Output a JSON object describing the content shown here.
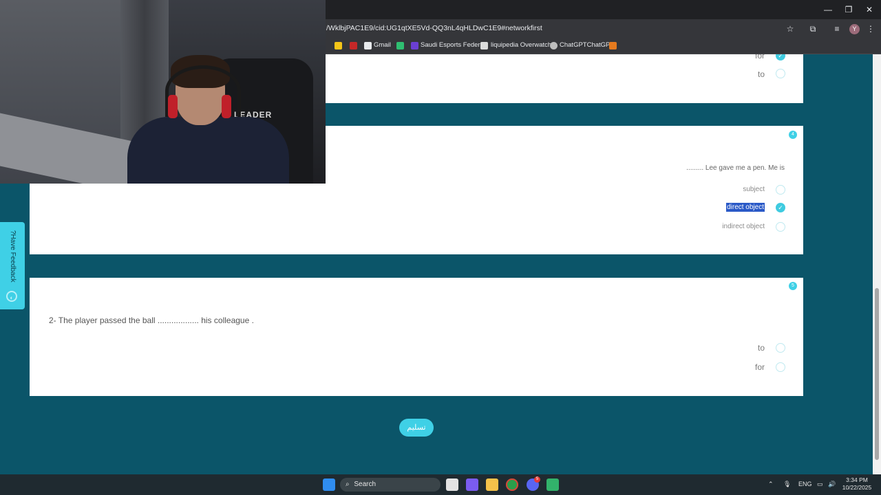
{
  "browser": {
    "url": "/WklbjPAC1E9/cid:UG1qtXE5Vd-QQ3nL4qHLDwC1E9#networkfirst",
    "profile_initial": "Y",
    "bookmarks": [
      "Gmail",
      "Saudi Esports Feder...",
      "liquipedia Overwatch",
      "ChatGPTChatGPT"
    ]
  },
  "overlay": {
    "chair_text": "LEADER"
  },
  "prev_card": {
    "options": [
      "for",
      "to"
    ]
  },
  "q4": {
    "number": "4",
    "text": "......... Lee gave me a pen. Me is",
    "options": [
      "subject",
      "direct object",
      "indirect object"
    ],
    "selected": "direct object"
  },
  "q5": {
    "number": "5",
    "text": "2- The player passed the ball .................. his colleague .",
    "options": [
      "to",
      "for"
    ]
  },
  "submit_label": "تسليم",
  "feedback_label": "?Have Feedback",
  "taskbar": {
    "search_label": "Search",
    "language": "ENG",
    "time": "3:34 PM",
    "date": "10/22/2025",
    "discord_badge": "5"
  },
  "colors": {
    "page_bg": "#0b5569",
    "accent": "#3fd0e6",
    "highlight": "#2a59c7"
  }
}
